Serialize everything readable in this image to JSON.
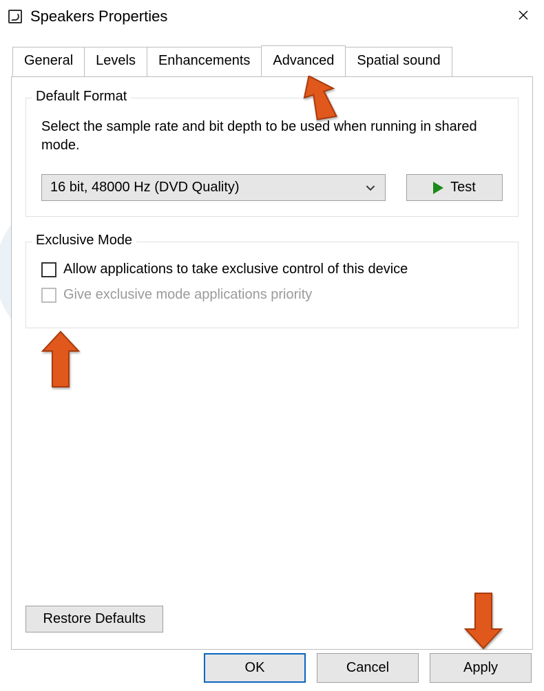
{
  "window": {
    "title": "Speakers Properties"
  },
  "tabs": {
    "general": "General",
    "levels": "Levels",
    "enhancements": "Enhancements",
    "advanced": "Advanced",
    "spatial": "Spatial sound",
    "active": "advanced"
  },
  "advanced": {
    "default_format": {
      "legend": "Default Format",
      "description": "Select the sample rate and bit depth to be used when running in shared mode.",
      "selected": "16 bit, 48000 Hz (DVD Quality)",
      "test_label": "Test"
    },
    "exclusive_mode": {
      "legend": "Exclusive Mode",
      "allow_label": "Allow applications to take exclusive control of this device",
      "allow_checked": false,
      "priority_label": "Give exclusive mode applications priority",
      "priority_enabled": false
    },
    "restore_defaults": "Restore Defaults"
  },
  "footer": {
    "ok": "OK",
    "cancel": "Cancel",
    "apply": "Apply"
  }
}
